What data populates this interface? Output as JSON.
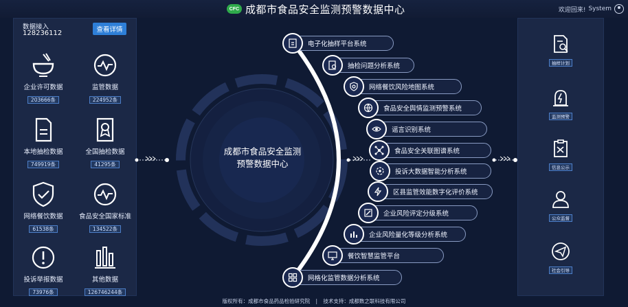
{
  "header": {
    "logo_text": "CFC",
    "title": "成都市食品安全监测预警数据中心",
    "welcome": "欢迎回来!",
    "user": "System"
  },
  "left": {
    "access_label": "数据接入",
    "access_value": "128236112",
    "detail_button": "查看详情",
    "stats": [
      {
        "icon": "bowl-icon",
        "label": "企业许可数据",
        "count": "203666条"
      },
      {
        "icon": "pulse-circle-icon",
        "label": "监管数据",
        "count": "224952条"
      },
      {
        "icon": "document-icon",
        "label": "本地抽检数据",
        "count": "749919条"
      },
      {
        "icon": "certificate-icon",
        "label": "全国抽检数据",
        "count": "41295条"
      },
      {
        "icon": "shield-check-icon",
        "label": "网络餐饮数据",
        "count": "61538条"
      },
      {
        "icon": "pulse-circle-icon",
        "label": "食品安全国家标准",
        "count": "134522条"
      },
      {
        "icon": "alert-circle-icon",
        "label": "投诉举报数据",
        "count": "73976条"
      },
      {
        "icon": "bar-chart-icon",
        "label": "其他数据",
        "count": "126746244条"
      }
    ]
  },
  "center": {
    "title_line1": "成都市食品安全监测",
    "title_line2": "预警数据中心",
    "systems": [
      {
        "icon": "clipboard-icon",
        "label": "电子化抽样平台系统"
      },
      {
        "icon": "doc-search-icon",
        "label": "抽检问题分析系统"
      },
      {
        "icon": "map-shield-icon",
        "label": "网络餐饮风险地图系统"
      },
      {
        "icon": "globe-icon",
        "label": "食品安全舆情监测预警系统"
      },
      {
        "icon": "eye-icon",
        "label": "谣言识别系统"
      },
      {
        "icon": "network-icon",
        "label": "食品安全关联图谱系统"
      },
      {
        "icon": "gear-chart-icon",
        "label": "投诉大数据智能分析系统"
      },
      {
        "icon": "lightning-icon",
        "label": "区县监管效能数字化评价系统"
      },
      {
        "icon": "edit-chart-icon",
        "label": "企业风险评定分级系统"
      },
      {
        "icon": "bar-eye-icon",
        "label": "企业风险量化等级分析系统"
      },
      {
        "icon": "monitor-icon",
        "label": "餐饮智慧监管平台"
      },
      {
        "icon": "grid-icon",
        "label": "网格化监管数据分析系统"
      }
    ]
  },
  "right": {
    "items": [
      {
        "icon": "doc-search-icon",
        "label": "抽样计划"
      },
      {
        "icon": "warning-bolt-icon",
        "label": "监测预警"
      },
      {
        "icon": "shuffle-clipboard-icon",
        "label": "信息公示"
      },
      {
        "icon": "person-icon",
        "label": "公众监督"
      },
      {
        "icon": "send-icon",
        "label": "社会引导"
      }
    ]
  },
  "footer": {
    "copyright": "版权所有：成都市食品药品检验研究院",
    "separator": "|",
    "support": "技术支持：成都数之联科技有限公司"
  },
  "colors": {
    "background": "#0f1a33",
    "panel": "#1b2846",
    "accent": "#2e7fd8",
    "badge_border": "#4d7fc9"
  }
}
